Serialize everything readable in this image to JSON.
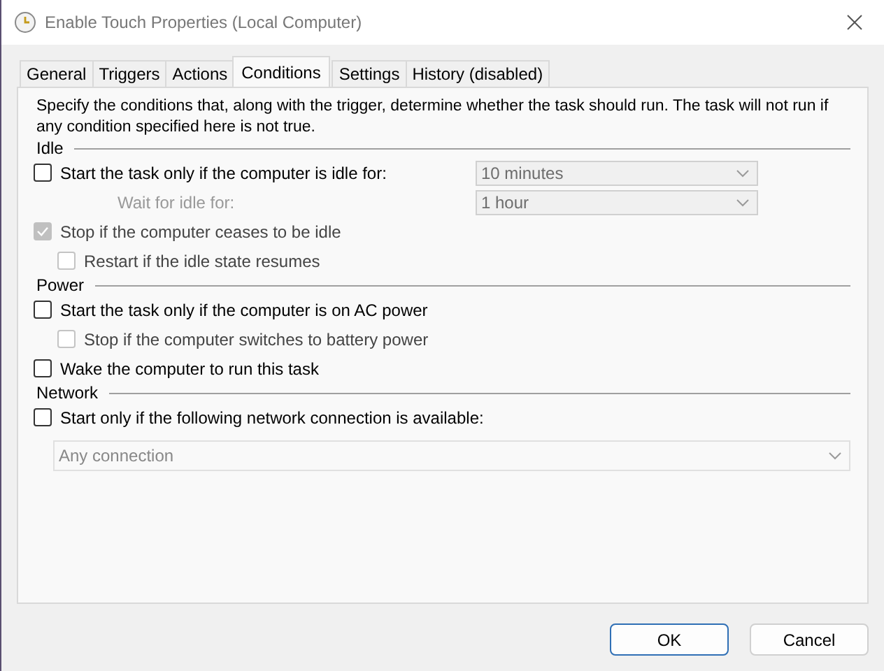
{
  "window": {
    "title": "Enable Touch Properties (Local Computer)"
  },
  "tabs": [
    {
      "label": "General",
      "selected": false
    },
    {
      "label": "Triggers",
      "selected": false
    },
    {
      "label": "Actions",
      "selected": false
    },
    {
      "label": "Conditions",
      "selected": true
    },
    {
      "label": "Settings",
      "selected": false
    },
    {
      "label": "History (disabled)",
      "selected": false
    }
  ],
  "description": "Specify the conditions that, along with the trigger, determine whether the task should run.  The task will not run  if any condition specified here is not true.",
  "sections": [
    {
      "title": "Idle",
      "items": [
        {
          "kind": "checkbox",
          "label": "Start the task only if the computer is idle for:",
          "checked": false,
          "disabled": false,
          "combo": {
            "value": "10 minutes",
            "disabled": true
          }
        },
        {
          "kind": "combo_row",
          "label": "Wait for idle for:",
          "disabled": true,
          "combo": {
            "value": "1 hour",
            "disabled": true
          }
        },
        {
          "kind": "checkbox",
          "label": "Stop if the computer ceases to be idle",
          "checked": true,
          "disabled": true,
          "children": [
            {
              "kind": "checkbox",
              "label": "Restart if the idle state resumes",
              "checked": false,
              "disabled": true
            }
          ]
        }
      ]
    },
    {
      "title": "Power",
      "items": [
        {
          "kind": "checkbox",
          "label": "Start the task only if the computer is on AC power",
          "checked": false,
          "disabled": false,
          "children": [
            {
              "kind": "checkbox",
              "label": "Stop if the computer switches to battery power",
              "checked": false,
              "disabled": true
            }
          ]
        },
        {
          "kind": "checkbox",
          "label": "Wake the computer to run this task",
          "checked": false,
          "disabled": false
        }
      ]
    },
    {
      "title": "Network",
      "items": [
        {
          "kind": "checkbox",
          "label": "Start only if the following network connection is available:",
          "checked": false,
          "disabled": false
        },
        {
          "kind": "dropdown",
          "combo": {
            "value": "Any connection",
            "disabled": true
          }
        }
      ]
    }
  ],
  "buttons": [
    {
      "label": "OK",
      "default": true
    },
    {
      "label": "Cancel",
      "default": false
    }
  ]
}
